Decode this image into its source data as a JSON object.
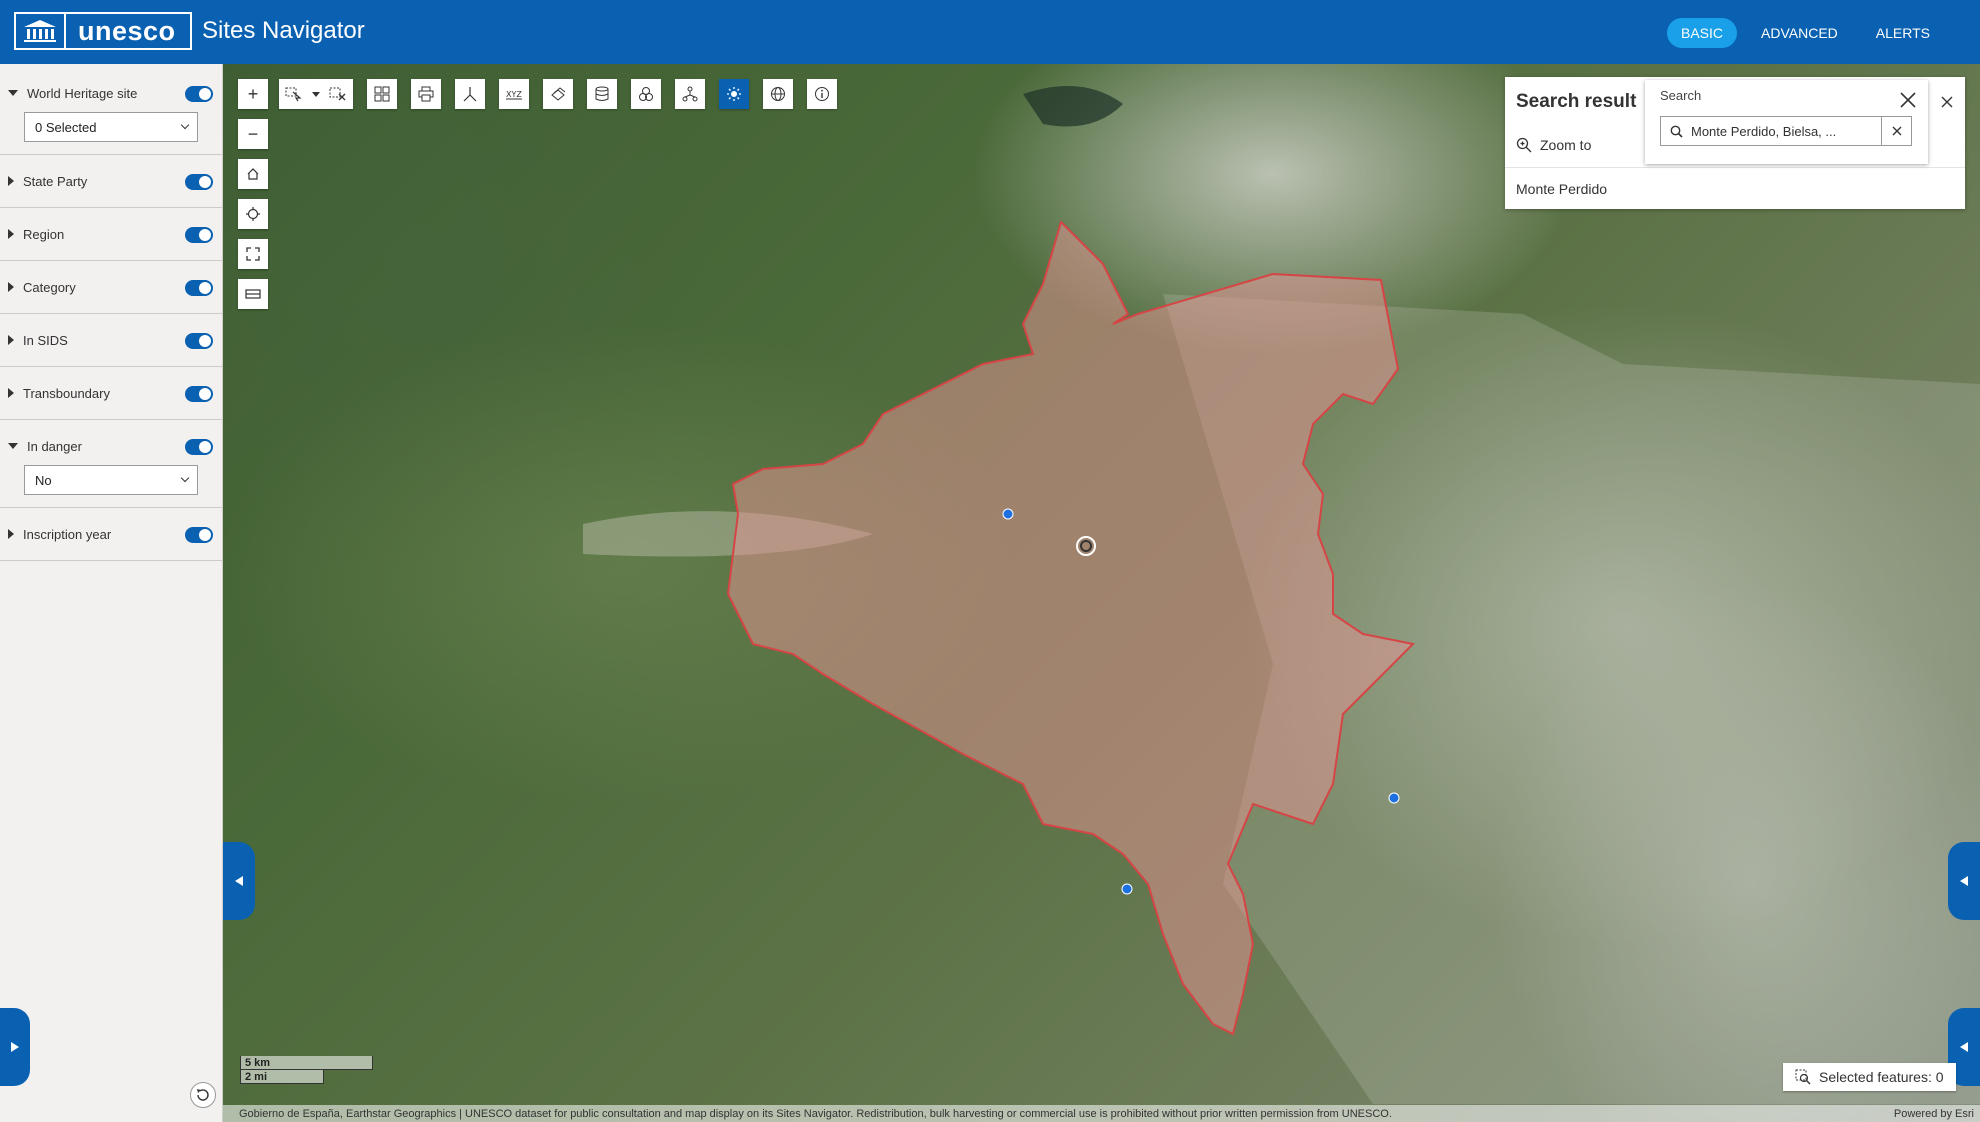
{
  "header": {
    "logo_text": "unesco",
    "app_title": "Sites Navigator",
    "nav": [
      {
        "label": "BASIC",
        "active": true
      },
      {
        "label": "ADVANCED",
        "active": false
      },
      {
        "label": "ALERTS",
        "active": false
      }
    ]
  },
  "sidebar": {
    "filters": [
      {
        "label": "World Heritage site",
        "expanded": true,
        "enabled": true,
        "select_value": "0 Selected"
      },
      {
        "label": "State Party",
        "expanded": false,
        "enabled": true
      },
      {
        "label": "Region",
        "expanded": false,
        "enabled": true
      },
      {
        "label": "Category",
        "expanded": false,
        "enabled": true
      },
      {
        "label": "In SIDS",
        "expanded": false,
        "enabled": true
      },
      {
        "label": "Transboundary",
        "expanded": false,
        "enabled": true
      },
      {
        "label": "In danger",
        "expanded": true,
        "enabled": true,
        "select_value": "No"
      },
      {
        "label": "Inscription year",
        "expanded": false,
        "enabled": true
      }
    ]
  },
  "map": {
    "zoom_in": "+",
    "zoom_out": "−",
    "toolbar_icons": [
      "select-icon",
      "clear-selection-icon",
      "basemap-gallery-icon",
      "print-icon",
      "measure-icon",
      "coordinates-icon",
      "layers-icon",
      "data-icon",
      "analysis-icon",
      "network-icon",
      "daylight-icon",
      "globe-icon",
      "info-icon"
    ],
    "scale_km": "5 km",
    "scale_mi": "2 mi",
    "selected_features_label": "Selected features: 0",
    "attribution": "Gobierno de España, Earthstar Geographics | UNESCO dataset for public consultation and map display on its Sites Navigator. Redistribution, bulk harvesting or commercial use is prohibited without prior written permission from UNESCO.",
    "powered_by": "Powered by Esri",
    "site_polygon_color": "#e8a0a0"
  },
  "search_result": {
    "title": "Search result",
    "zoom_to_label": "Zoom to",
    "items": [
      "Monte Perdido"
    ]
  },
  "search": {
    "label": "Search",
    "value": "Monte Perdido, Bielsa, ..."
  }
}
